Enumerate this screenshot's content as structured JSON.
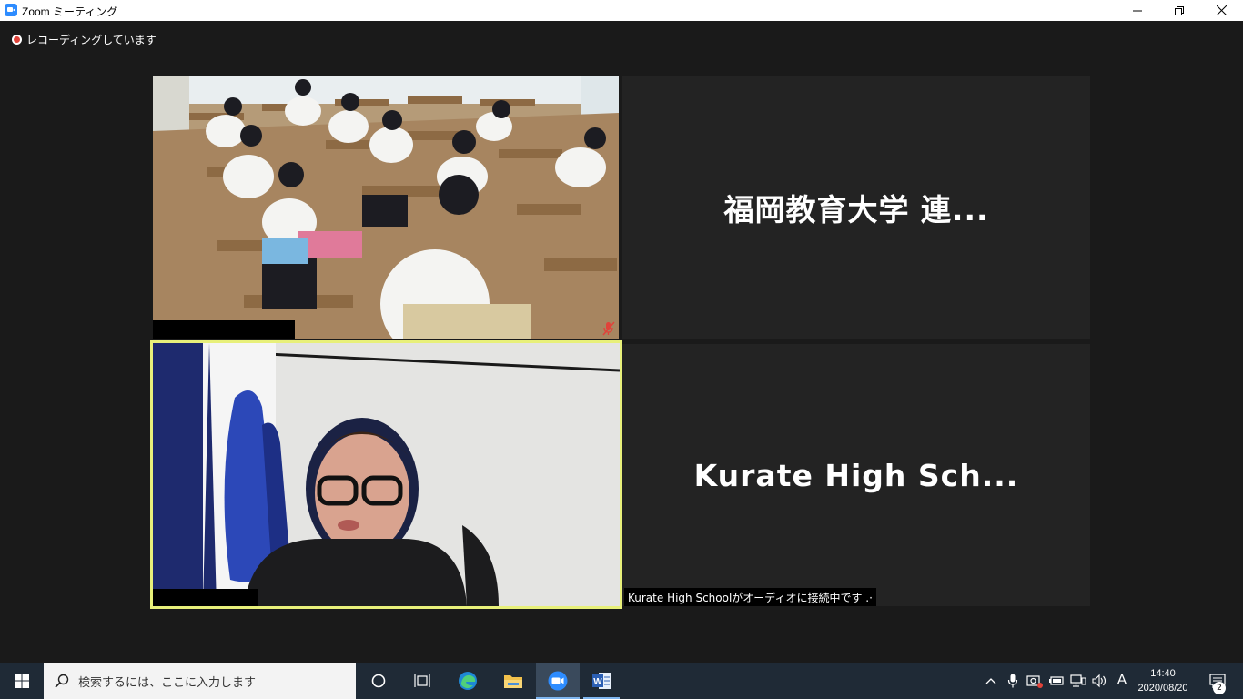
{
  "window": {
    "title": "Zoom ミーティング"
  },
  "recording": {
    "label": "レコーディングしています"
  },
  "participants": [
    {
      "display_name": "福岡教育大学 連...",
      "video": "classroom",
      "muted": true
    },
    {
      "display_name": "Kurate High Sch...",
      "video": "teacher-with-headphones",
      "active_speaker": true
    }
  ],
  "status": {
    "audio_connecting": "Kurate High Schoolがオーディオに接続中です .·"
  },
  "taskbar": {
    "search_placeholder": "検索するには、ここに入力します",
    "time": "14:40",
    "date": "2020/08/20",
    "ime": "A",
    "notification_count": "2",
    "apps": [
      "cortana-icon",
      "task-view-icon",
      "edge-icon",
      "file-explorer-icon",
      "zoom-icon",
      "word-icon"
    ]
  },
  "colors": {
    "accent_speaker_border": "#e8f07a",
    "zoom_blue": "#2d8cff",
    "recording_red": "#e0433a",
    "taskbar_bg": "#1f2a36"
  }
}
